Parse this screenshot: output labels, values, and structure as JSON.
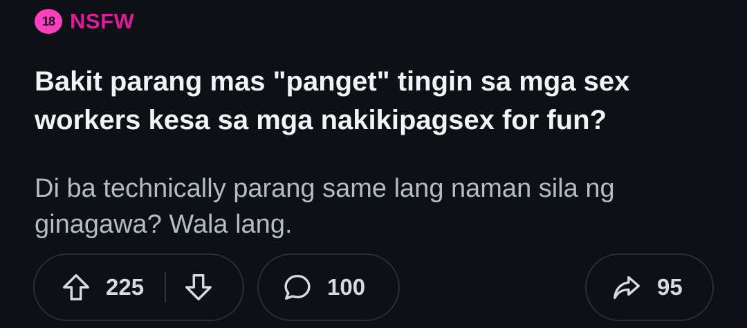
{
  "nsfw": {
    "badge_text": "18",
    "label": "NSFW",
    "badge_color": "#ff3fbf",
    "label_color": "#e01a9a"
  },
  "post": {
    "title": "Bakit parang mas \"panget\" tingin sa mga sex\nworkers kesa sa mga nakikipagsex for fun?",
    "body": "Di ba technically parang same lang naman sila ng\nginagawa? Wala lang."
  },
  "actions": {
    "upvote_count": "225",
    "comment_count": "100",
    "share_count": "95"
  },
  "icons": {
    "upvote": "arrow-up-outline-icon",
    "downvote": "arrow-down-outline-icon",
    "comment": "speech-bubble-icon",
    "share": "share-arrow-icon"
  },
  "colors": {
    "background": "#0d1014",
    "title": "#f2f3f5",
    "body": "#b4bcc6",
    "pill_border": "#2a2f36"
  }
}
